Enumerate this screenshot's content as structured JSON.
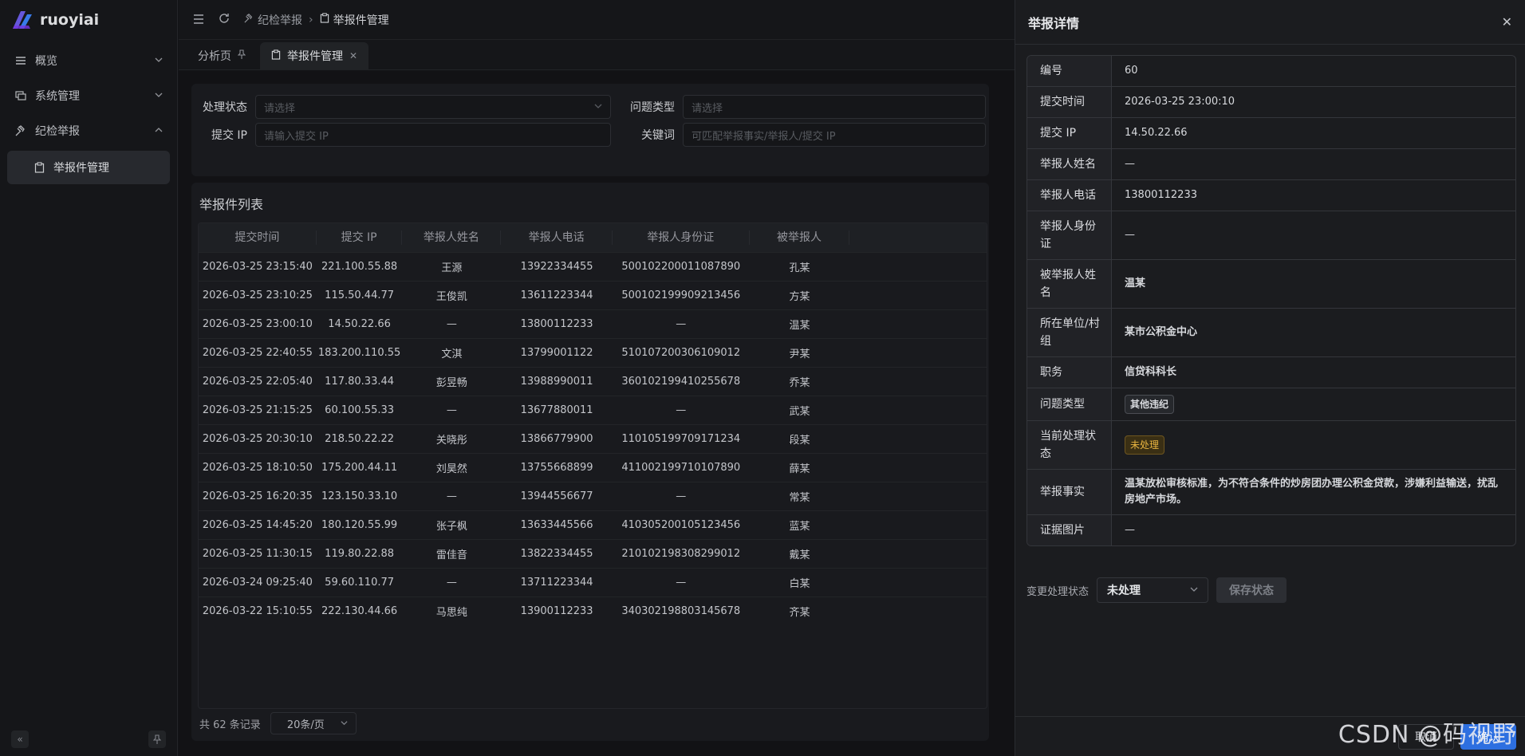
{
  "app": {
    "name": "ruoyiai"
  },
  "sidebar": {
    "items": [
      {
        "label": "概览",
        "icon": "list-icon",
        "expanded": false
      },
      {
        "label": "系统管理",
        "icon": "monitor-icon",
        "expanded": false
      },
      {
        "label": "纪检举报",
        "icon": "gavel-icon",
        "expanded": true
      }
    ],
    "sub_item": {
      "label": "举报件管理",
      "icon": "clipboard-icon"
    }
  },
  "header": {
    "breadcrumbs": [
      {
        "label": "纪检举报"
      },
      {
        "label": "举报件管理"
      }
    ]
  },
  "tabs": [
    {
      "label": "分析页",
      "pinned": true
    },
    {
      "label": "举报件管理",
      "active": true
    }
  ],
  "filters": {
    "status_label": "处理状态",
    "status_placeholder": "请选择",
    "type_label": "问题类型",
    "type_placeholder": "请选择",
    "ip_label": "提交 IP",
    "ip_placeholder": "请输入提交 IP",
    "keyword_label": "关键词",
    "keyword_placeholder": "可匹配举报事实/举报人/提交 IP"
  },
  "list": {
    "title": "举报件列表",
    "columns": [
      "提交时间",
      "提交 IP",
      "举报人姓名",
      "举报人电话",
      "举报人身份证",
      "被举报人"
    ],
    "rows": [
      [
        "2026-03-25 23:15:40",
        "221.100.55.88",
        "王源",
        "13922334455",
        "500102200011087890",
        "孔某"
      ],
      [
        "2026-03-25 23:10:25",
        "115.50.44.77",
        "王俊凯",
        "13611223344",
        "500102199909213456",
        "方某"
      ],
      [
        "2026-03-25 23:00:10",
        "14.50.22.66",
        "—",
        "13800112233",
        "—",
        "温某"
      ],
      [
        "2026-03-25 22:40:55",
        "183.200.110.55",
        "文淇",
        "13799001122",
        "510107200306109012",
        "尹某"
      ],
      [
        "2026-03-25 22:05:40",
        "117.80.33.44",
        "彭昱畅",
        "13988990011",
        "360102199410255678",
        "乔某"
      ],
      [
        "2026-03-25 21:15:25",
        "60.100.55.33",
        "—",
        "13677880011",
        "—",
        "武某"
      ],
      [
        "2026-03-25 20:30:10",
        "218.50.22.22",
        "关晓彤",
        "13866779900",
        "110105199709171234",
        "段某"
      ],
      [
        "2026-03-25 18:10:50",
        "175.200.44.11",
        "刘昊然",
        "13755668899",
        "411002199710107890",
        "薛某"
      ],
      [
        "2026-03-25 16:20:35",
        "123.150.33.10",
        "—",
        "13944556677",
        "—",
        "常某"
      ],
      [
        "2026-03-25 14:45:20",
        "180.120.55.99",
        "张子枫",
        "13633445566",
        "410305200105123456",
        "蓝某"
      ],
      [
        "2026-03-25 11:30:15",
        "119.80.22.88",
        "雷佳音",
        "13822334455",
        "210102198308299012",
        "戴某"
      ],
      [
        "2026-03-24 09:25:40",
        "59.60.110.77",
        "—",
        "13711223344",
        "—",
        "白某"
      ],
      [
        "2026-03-22 15:10:55",
        "222.130.44.66",
        "马思纯",
        "13900112233",
        "340302198803145678",
        "齐某"
      ]
    ],
    "total_text": "共 62 条记录",
    "page_size": "20条/页"
  },
  "drawer": {
    "title": "举报详情",
    "fields": [
      {
        "label": "编号",
        "value": "60"
      },
      {
        "label": "提交时间",
        "value": "2026-03-25 23:00:10"
      },
      {
        "label": "提交 IP",
        "value": "14.50.22.66"
      },
      {
        "label": "举报人姓名",
        "value": "—"
      },
      {
        "label": "举报人电话",
        "value": "13800112233"
      },
      {
        "label": "举报人身份证",
        "value": "—"
      },
      {
        "label": "被举报人姓名",
        "value": "温某"
      },
      {
        "label": "所在单位/村组",
        "value": "某市公积金中心"
      },
      {
        "label": "职务",
        "value": "信贷科科长"
      },
      {
        "label": "问题类型",
        "value": "其他违纪"
      },
      {
        "label": "当前处理状态",
        "value": "未处理"
      },
      {
        "label": "举报事实",
        "value": "温某放松审核标准，为不符合条件的炒房团办理公积金贷款，涉嫌利益输送，扰乱房地产市场。"
      },
      {
        "label": "证据图片",
        "value": "—"
      }
    ],
    "status_change_label": "变更处理状态",
    "status_select_value": "未处理",
    "save_label": "保存状态",
    "cancel_label": "取消",
    "ok_label": "确认"
  },
  "watermark": "CSDN @码视野",
  "colors": {
    "accent": "#2d6fe0",
    "warning": "#e8b440",
    "background": "#151619"
  }
}
